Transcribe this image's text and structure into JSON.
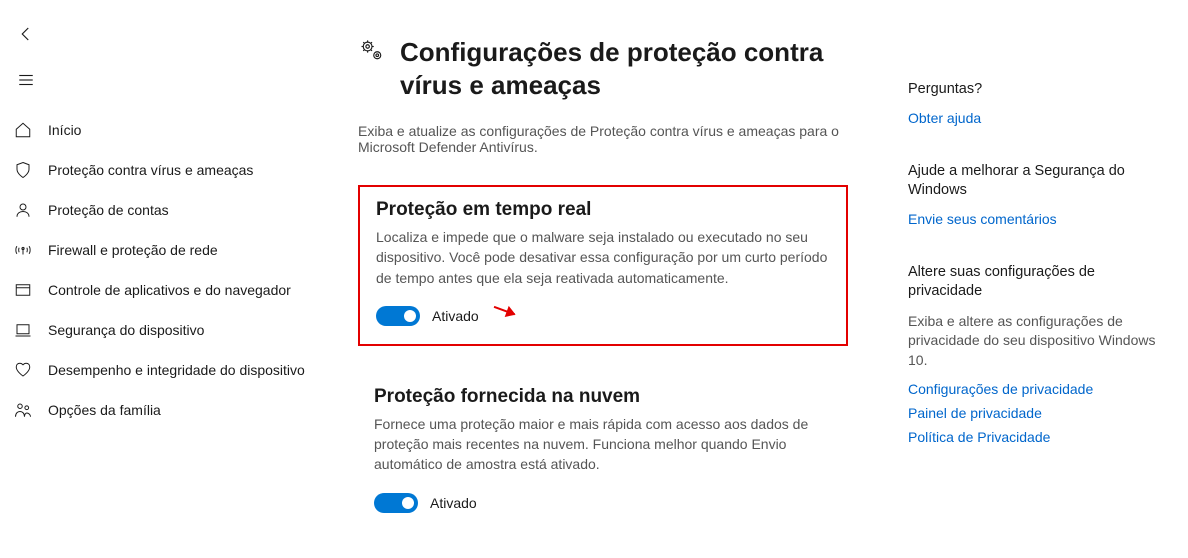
{
  "sidebar": {
    "items": [
      {
        "label": "Início"
      },
      {
        "label": "Proteção contra vírus e ameaças"
      },
      {
        "label": "Proteção de contas"
      },
      {
        "label": "Firewall e proteção de rede"
      },
      {
        "label": "Controle de aplicativos e do navegador"
      },
      {
        "label": "Segurança do dispositivo"
      },
      {
        "label": "Desempenho e integridade do dispositivo"
      },
      {
        "label": "Opções da família"
      }
    ]
  },
  "main": {
    "title": "Configurações de proteção contra vírus e ameaças",
    "subtitle": "Exiba e atualize as configurações de Proteção contra vírus e ameaças para o Microsoft Defender Antivírus.",
    "realtime": {
      "title": "Proteção em tempo real",
      "desc": "Localiza e impede que o malware seja instalado ou executado no seu dispositivo. Você pode desativar essa configuração por um curto período de tempo antes que ela seja reativada automaticamente.",
      "state": "Ativado"
    },
    "cloud": {
      "title": "Proteção fornecida na nuvem",
      "desc": "Fornece uma proteção maior e mais rápida com acesso aos dados de proteção mais recentes na nuvem. Funciona melhor quando Envio automático de amostra está ativado.",
      "state": "Ativado"
    }
  },
  "right": {
    "questions": {
      "heading": "Perguntas?",
      "help": "Obter ajuda"
    },
    "improve": {
      "heading": "Ajude a melhorar a Segurança do Windows",
      "feedback": "Envie seus comentários"
    },
    "privacy": {
      "heading": "Altere suas configurações de privacidade",
      "text": "Exiba e altere as configurações de privacidade do seu dispositivo Windows 10.",
      "link1": "Configurações de privacidade",
      "link2": "Painel de privacidade",
      "link3": "Política de Privacidade"
    }
  }
}
